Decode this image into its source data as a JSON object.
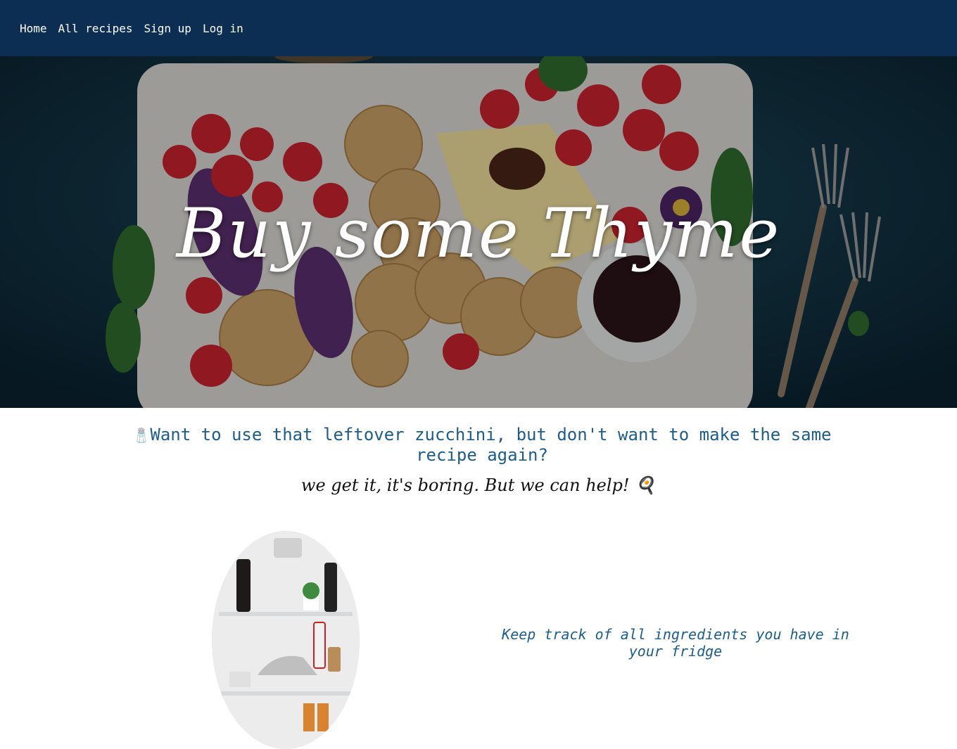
{
  "nav": {
    "items": [
      {
        "label": "Home"
      },
      {
        "label": "All recipes"
      },
      {
        "label": "Sign up"
      },
      {
        "label": "Log in"
      }
    ]
  },
  "hero": {
    "title": "Buy some Thyme"
  },
  "intro": {
    "emoji": "🧂",
    "question": "Want to use that leftover zucchini, but don't want to make the same recipe again?",
    "tagline": "we get it, it's boring. But we can help! 🍳"
  },
  "feature": {
    "text": "Keep track of all ingredients you have in your fridge"
  },
  "colors": {
    "nav_bg": "#0b2e52",
    "accent_text": "#1c5d8c"
  }
}
